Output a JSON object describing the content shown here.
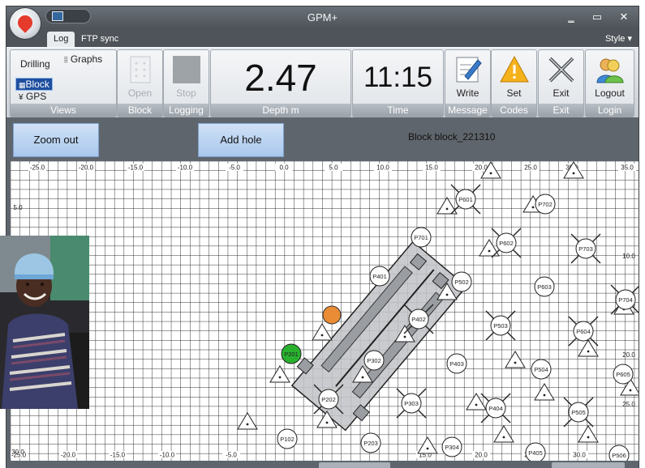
{
  "window": {
    "title": "GPM+",
    "controls": {
      "minimize": "‗",
      "maximize": "▭",
      "close": "✕"
    }
  },
  "ribbon_tabs": [
    "Log",
    "FTP sync"
  ],
  "style_menu": "Style ▾",
  "ribbon": {
    "views": {
      "items": [
        "Drilling",
        "Graphs",
        "Block",
        "GPS"
      ],
      "caption": "Views"
    },
    "block": {
      "label": "Open",
      "caption": "Block"
    },
    "logging": {
      "label": "Stop",
      "caption": "Logging"
    },
    "depth": {
      "value": "2.47",
      "caption": "Depth m"
    },
    "time": {
      "value": "11:15",
      "caption": "Time"
    },
    "message": {
      "label": "Write",
      "caption": "Message"
    },
    "codes": {
      "label": "Set",
      "caption": "Codes"
    },
    "exit": {
      "label": "Exit",
      "caption": "Exit"
    },
    "login": {
      "label": "Logout",
      "caption": "Login"
    }
  },
  "toolbar": {
    "zoom_out": "Zoom out",
    "add_hole": "Add hole",
    "block_label": "Block block_221310"
  },
  "map": {
    "x_labels": [
      "-25.0",
      "-20.0",
      "-15.0",
      "-10.0",
      "-5.0",
      "0.0",
      "5.0",
      "10.0",
      "15.0",
      "20.0",
      "25.0",
      "30.0",
      "35.0"
    ],
    "y_labels_left": [
      "5.0",
      "30.0"
    ],
    "y_labels_right": [
      "10.0",
      "15.0",
      "20.0",
      "25.0"
    ],
    "bottom_labels": [
      "-25.0",
      "-20.0",
      "-15.0",
      "-10.0",
      "-5.0",
      "15.0",
      "20.0",
      "25.0",
      "30.0"
    ],
    "holes": [
      "P601",
      "P702",
      "P701",
      "P602",
      "P703",
      "P401",
      "P502",
      "P603",
      "P704",
      "P402",
      "P503",
      "P604",
      "P201",
      "P302",
      "P403",
      "P504",
      "P605",
      "P202",
      "P303",
      "P404",
      "P505",
      "P102",
      "P203",
      "P304",
      "P405",
      "P506"
    ],
    "colors": {
      "active_hole": "#29b12e",
      "drill": "#e98c35",
      "rig": "#bfc2c6"
    }
  }
}
